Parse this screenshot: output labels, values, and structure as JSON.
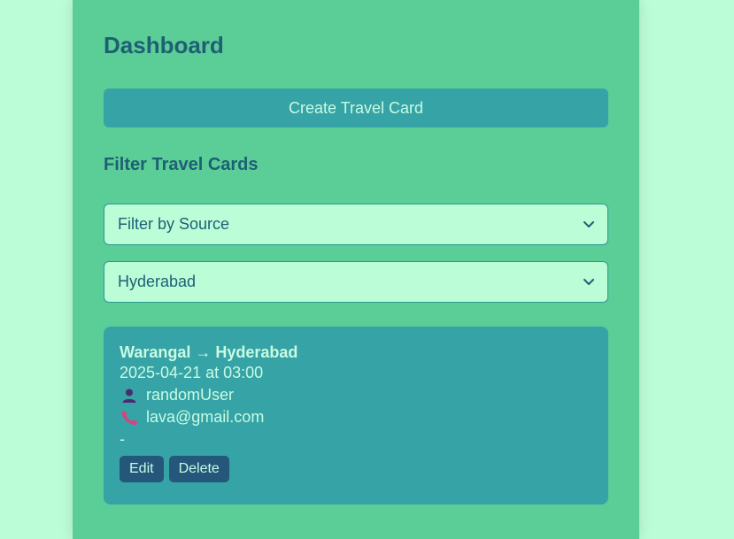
{
  "page": {
    "title": "Dashboard",
    "create_button_label": "Create Travel Card",
    "filter_heading": "Filter Travel Cards"
  },
  "filters": {
    "source_selected": "Filter by Source",
    "destination_selected": "Hyderabad"
  },
  "card": {
    "route": "Warangal → Hyderabad",
    "datetime": "2025-04-21 at 03:00",
    "user": "randomUser",
    "contact": "lava@gmail.com",
    "note": "-",
    "edit_label": "Edit",
    "delete_label": "Delete",
    "icons": {
      "user": "user-icon",
      "contact": "phone-icon"
    }
  },
  "colors": {
    "background": "#bbfdd7",
    "panel": "#5ace96",
    "heading": "#1e5f74",
    "accent": "#36a3a6",
    "card_button": "#24577a",
    "light_text": "#c8fbe4"
  }
}
